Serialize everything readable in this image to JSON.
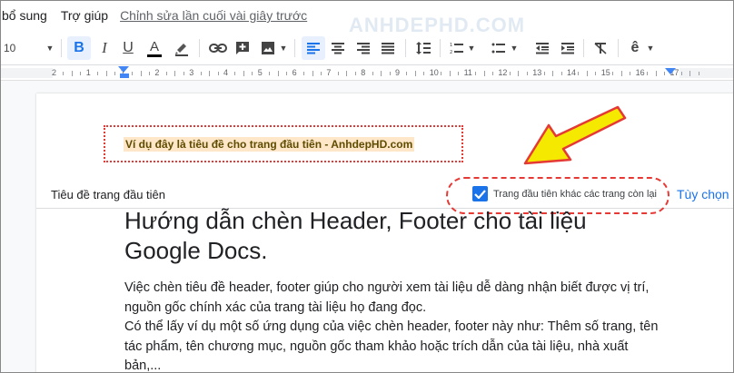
{
  "menu": {
    "items": [
      "bổ sung",
      "Trợ giúp"
    ],
    "last_edit": "Chỉnh sửa lần cuối vài giây trước"
  },
  "toolbar": {
    "zoom": "10",
    "bold_label": "B",
    "italic_label": "I",
    "underline_label": "U",
    "text_color_label": "A",
    "accent_color": "#1a73e8"
  },
  "watermark": "ANHDEPHD.COM",
  "ruler": {
    "numbers": [
      "2",
      "1",
      "1",
      "2",
      "3",
      "4",
      "5",
      "6",
      "7",
      "8",
      "9",
      "10",
      "11",
      "12",
      "13",
      "14",
      "15",
      "16",
      "17"
    ]
  },
  "header": {
    "text": "Ví dụ đây là tiêu đề cho trang đầu tiên - AnhdepHD.com",
    "bar_label": "Tiêu đề trang đầu tiên",
    "checkbox_label": "Trang đầu tiên khác các trang còn lại",
    "checkbox_checked": true,
    "options_link": "Tùy chọn"
  },
  "document": {
    "title_lines": [
      "Hướng dẫn chèn Header, Footer cho tài liệu",
      "Google Docs."
    ],
    "body_lines": [
      "Việc chèn tiêu đề header, footer giúp cho người xem tài liệu dễ dàng nhận biết được vị trí,",
      "nguồn gốc chính xác của trang tài liệu họ đang đọc.",
      "Có thể lấy ví dụ một số ứng dụng của việc chèn header, footer này như: Thêm số trang, tên",
      "tác phẩm, tên chương mục, nguồn gốc tham khảo hoặc trích dẫn của tài liệu, nhà xuất",
      "bản,..."
    ]
  },
  "annotation": {
    "arrow_color": "#f5e900",
    "outline_color": "#e53935"
  }
}
